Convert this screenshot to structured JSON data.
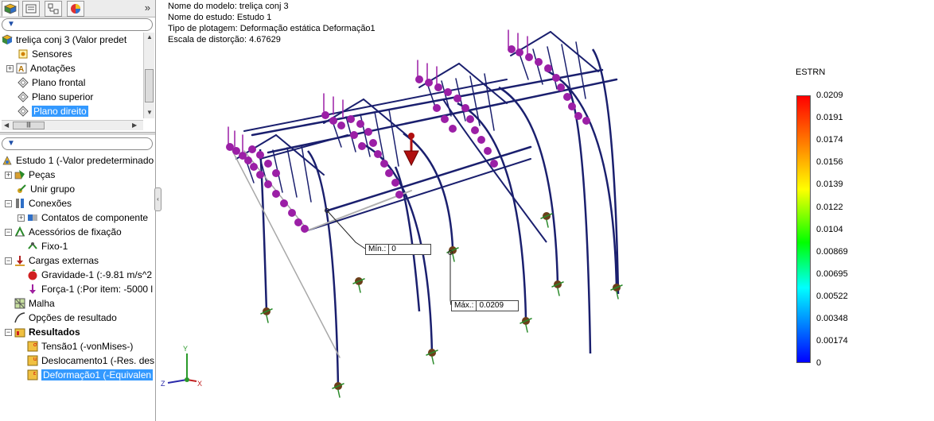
{
  "panel": {
    "expand_glyph": "»",
    "tabs": [
      "feature-manager-icon",
      "property-manager-icon",
      "configuration-manager-icon",
      "display-manager-icon"
    ],
    "model_tree": [
      {
        "label": "treliça conj 3  (Valor predet",
        "icon": "assembly-icon"
      },
      {
        "label": "Sensores",
        "icon": "sensor-icon"
      },
      {
        "label": "Anotações",
        "icon": "annotation-icon"
      },
      {
        "label": "Plano frontal",
        "icon": "plane-icon"
      },
      {
        "label": "Plano superior",
        "icon": "plane-icon"
      },
      {
        "label": "Plano direito",
        "icon": "plane-icon"
      }
    ],
    "study_tree": [
      {
        "label": "Estudo 1 (-Valor predeterminado",
        "icon": "study-icon"
      },
      {
        "label": "Peças",
        "icon": "parts-icon"
      },
      {
        "label": "Unir grupo",
        "icon": "joint-group-icon"
      },
      {
        "label": "Conexões",
        "icon": "connections-icon"
      },
      {
        "label": "Contatos de componente",
        "icon": "contacts-icon"
      },
      {
        "label": "Acessórios de fixação",
        "icon": "fixtures-icon"
      },
      {
        "label": "Fixo-1",
        "icon": "fixed-icon"
      },
      {
        "label": "Cargas externas",
        "icon": "external-loads-icon"
      },
      {
        "label": "Gravidade-1 (:-9.81 m/s^2",
        "icon": "gravity-icon"
      },
      {
        "label": "Força-1 (:Por item: -5000 l",
        "icon": "force-icon"
      },
      {
        "label": "Malha",
        "icon": "mesh-icon"
      },
      {
        "label": "Opções de resultado",
        "icon": "result-options-icon"
      },
      {
        "label": "Resultados",
        "icon": "results-folder-icon"
      },
      {
        "label": "Tensão1 (-vonMises-)",
        "icon": "stress-plot-icon"
      },
      {
        "label": "Deslocamento1 (-Res. des",
        "icon": "displacement-plot-icon"
      },
      {
        "label": "Deformação1 (-Equivalen",
        "icon": "strain-plot-icon"
      }
    ],
    "scroll_left": "◀",
    "scroll_right": "▶",
    "scroll_up": "▲",
    "scroll_down": "▼",
    "scroll_grip": "|||"
  },
  "viewport": {
    "info": [
      "Nome do modelo: treliça conj 3",
      "Nome do estudo: Estudo 1",
      "Tipo de plotagem: Deformação estática Deformação1",
      "Escala de distorção: 4.67629"
    ],
    "min_label": "Mín.:",
    "min_value": "0",
    "max_label": "Máx.:",
    "max_value": "0.0209",
    "axes": {
      "y": "Y",
      "z": "Z",
      "x": "X"
    },
    "legend": {
      "title": "ESTRN",
      "ticks": [
        "0.0209",
        "0.0191",
        "0.0174",
        "0.0156",
        "0.0139",
        "0.0122",
        "0.0104",
        "0.00869",
        "0.00695",
        "0.00522",
        "0.00348",
        "0.00174",
        "0"
      ],
      "colors": [
        "#ff0000",
        "#ff8000",
        "#ffff00",
        "#00ff00",
        "#00ffff",
        "#0080ff",
        "#0000ff"
      ]
    },
    "colors": {
      "frame": "#1a1f6e",
      "load_marker": "#9b1fa6",
      "fixture": "#6b3f1a",
      "force_arrow": "#b01010"
    }
  }
}
